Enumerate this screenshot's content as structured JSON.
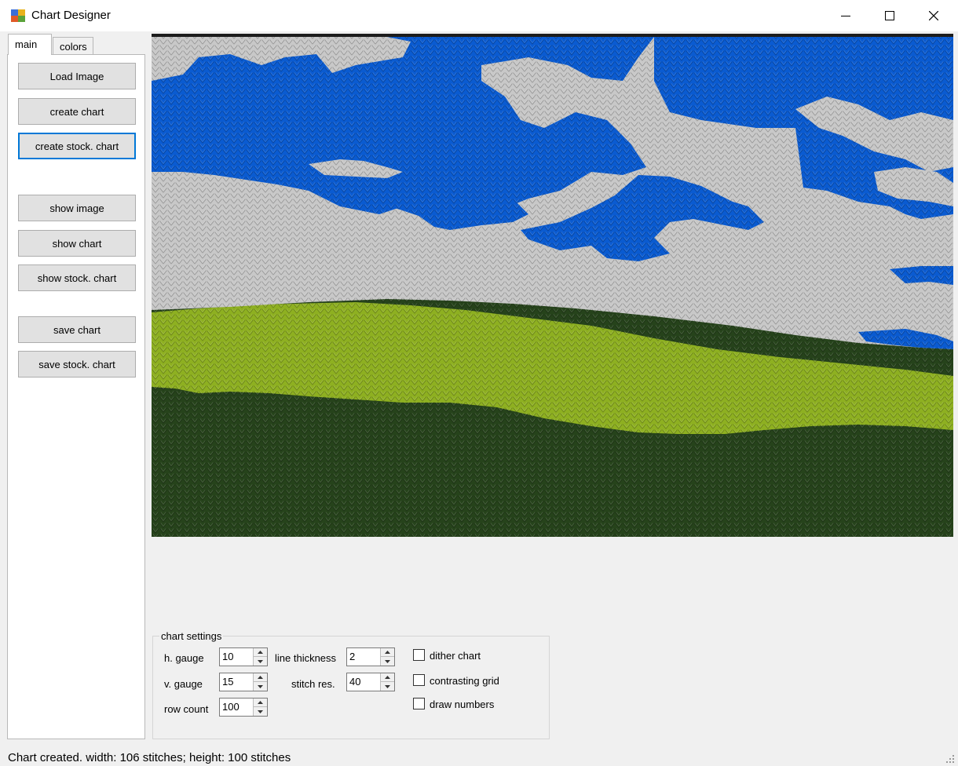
{
  "window": {
    "title": "Chart Designer"
  },
  "tabs": [
    {
      "label": "main",
      "active": true
    },
    {
      "label": "colors",
      "active": false
    }
  ],
  "buttons": {
    "load_image": "Load Image",
    "create_chart": "create chart",
    "create_stock_chart": "create stock. chart",
    "show_image": "show image",
    "show_chart": "show chart",
    "show_stock_chart": "show stock. chart",
    "save_chart": "save chart",
    "save_stock_chart": "save stock. chart"
  },
  "chart_settings": {
    "group_label": "chart settings",
    "h_gauge": {
      "label": "h. gauge",
      "value": "10"
    },
    "v_gauge": {
      "label": "v. gauge",
      "value": "15"
    },
    "row_count": {
      "label": "row count",
      "value": "100"
    },
    "line_thickness": {
      "label": "line thickness",
      "value": "2"
    },
    "stitch_res": {
      "label": "stitch res.",
      "value": "40"
    },
    "dither_chart": {
      "label": "dither chart",
      "checked": false
    },
    "contrasting_grid": {
      "label": "contrasting grid",
      "checked": false
    },
    "draw_numbers": {
      "label": "draw numbers",
      "checked": false
    }
  },
  "status": {
    "text": "Chart created. width: 106 stitches; height: 100 stitches"
  },
  "colors": {
    "sky_blue": "#0a5bd1",
    "cloud_gray": "#c8c8c8",
    "light_green": "#8eb021",
    "dark_green": "#26431b",
    "focus_blue": "#0078d7"
  }
}
